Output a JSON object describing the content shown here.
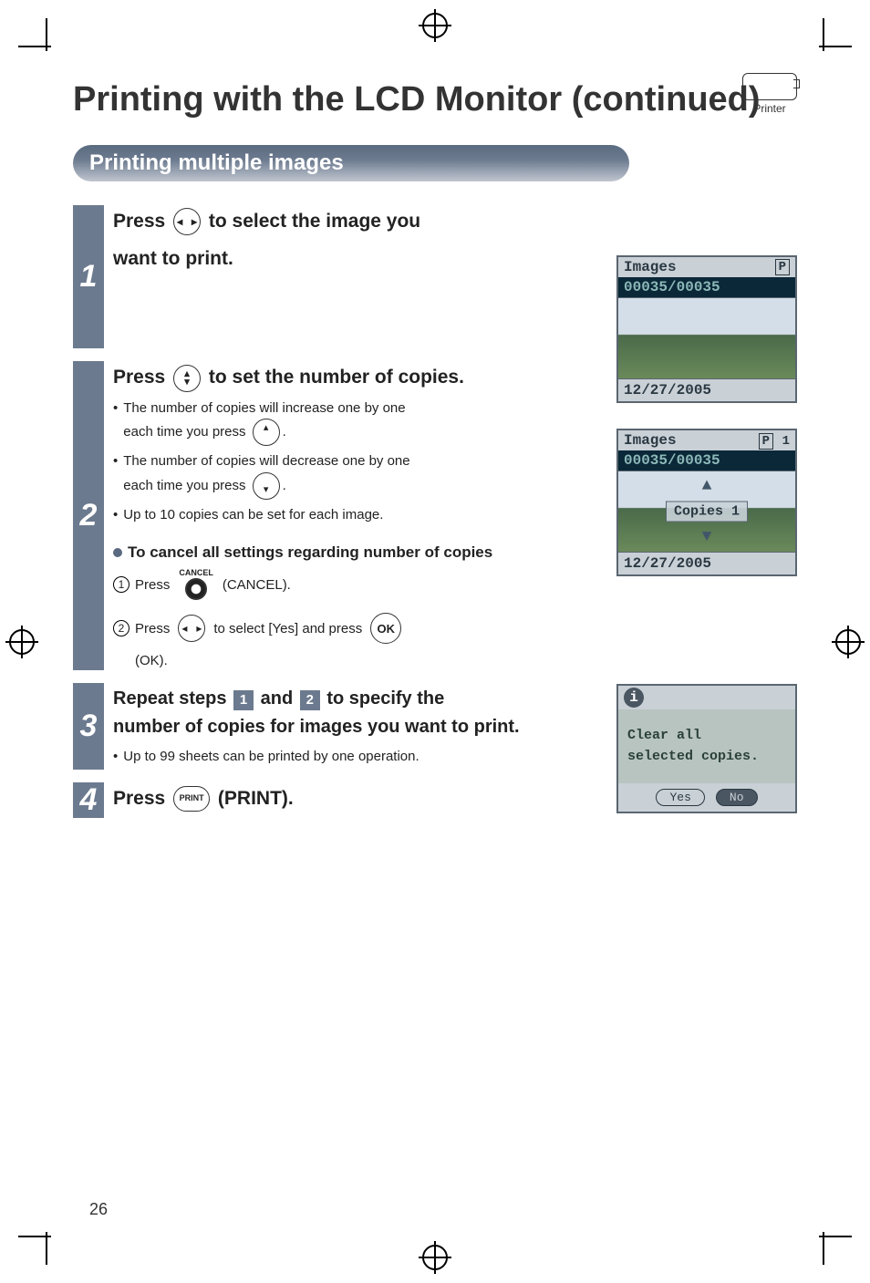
{
  "title": "Printing with the LCD Monitor (continued)",
  "printer_label": "Printer",
  "section_heading": "Printing multiple images",
  "steps": {
    "s1": {
      "num": "1",
      "lead_a": "Press ",
      "lead_b": " to select the image you",
      "lead_c": "want to print."
    },
    "s2": {
      "num": "2",
      "lead_a": "Press ",
      "lead_b": " to set the number of copies.",
      "b1a": "The number of copies will increase one by one",
      "b1b": "each time you press ",
      "b1c": ".",
      "b2a": "The number of copies will decrease one by one",
      "b2b": "each time you press ",
      "b2c": ".",
      "b3": "Up to 10 copies can be set for each image.",
      "sub_head": "To cancel all settings regarding number of copies",
      "cancel_label": "CANCEL",
      "sub1a": "Press ",
      "sub1b": " (CANCEL).",
      "sub2a": "Press ",
      "sub2b": " to select [Yes] and press ",
      "sub2c": "(OK).",
      "ok_label": "OK"
    },
    "s3": {
      "num": "3",
      "lead_a": "Repeat steps ",
      "badge1": "1",
      "lead_b": " and ",
      "badge2": "2",
      "lead_c": " to specify the",
      "lead_d": "number of copies for images you want to print.",
      "b1": "Up to 99 sheets can be printed by one operation."
    },
    "s4": {
      "num": "4",
      "lead_a": "Press ",
      "print_label": "PRINT",
      "lead_b": " (PRINT)."
    }
  },
  "lcds": {
    "l1": {
      "title": "Images",
      "p": "P",
      "counter": "00035/00035",
      "date": "12/27/2005"
    },
    "l2": {
      "title": "Images",
      "p": "P",
      "topnum": "1",
      "counter": "00035/00035",
      "copies": "Copies 1",
      "date": "12/27/2005"
    },
    "l3": {
      "msg1": "Clear all",
      "msg2": "selected copies.",
      "yes": "Yes",
      "no": "No"
    }
  },
  "page_number": "26"
}
